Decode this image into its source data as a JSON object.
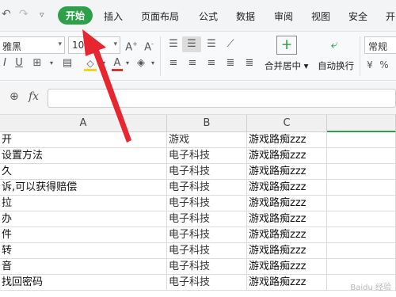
{
  "menubar": {
    "undo_icon": "undo-icon",
    "redo_icon": "redo-icon",
    "dropdown_icon": "chevron-down-icon",
    "tabs": [
      "开始",
      "插入",
      "页面布局",
      "公式",
      "数据",
      "审阅",
      "视图",
      "安全",
      "开"
    ]
  },
  "ribbon": {
    "font_name": "雅黑",
    "font_size": "10",
    "grow_font": "A⁺",
    "shrink_font": "A⁻",
    "merge_label": "合并居中",
    "wrap_label": "自动换行",
    "format_label": "常规",
    "font_color": "#e0312c",
    "fill_color": "#f5d21f"
  },
  "formula_bar": {
    "zoom_icon": "zoom-icon",
    "fx_label": "fx",
    "value": ""
  },
  "sheet": {
    "columns": [
      "A",
      "B",
      "C"
    ],
    "rows": [
      [
        "开",
        "游戏",
        "游戏路痴zzz"
      ],
      [
        "设置方法",
        "电子科技",
        "游戏路痴zzz"
      ],
      [
        "久",
        "电子科技",
        "游戏路痴zzz"
      ],
      [
        "诉,可以获得赔偿",
        "电子科技",
        "游戏路痴zzz"
      ],
      [
        "拉",
        "电子科技",
        "游戏路痴zzz"
      ],
      [
        "办",
        "电子科技",
        "游戏路痴zzz"
      ],
      [
        "件",
        "电子科技",
        "游戏路痴zzz"
      ],
      [
        "转",
        "电子科技",
        "游戏路痴zzz"
      ],
      [
        "音",
        "电子科技",
        "游戏路痴zzz"
      ],
      [
        "找回密码",
        "电子科技",
        "游戏路痴zzz"
      ]
    ]
  },
  "overlay": {
    "arrow_color": "#e8262f",
    "watermark": "Baidu 经验"
  }
}
